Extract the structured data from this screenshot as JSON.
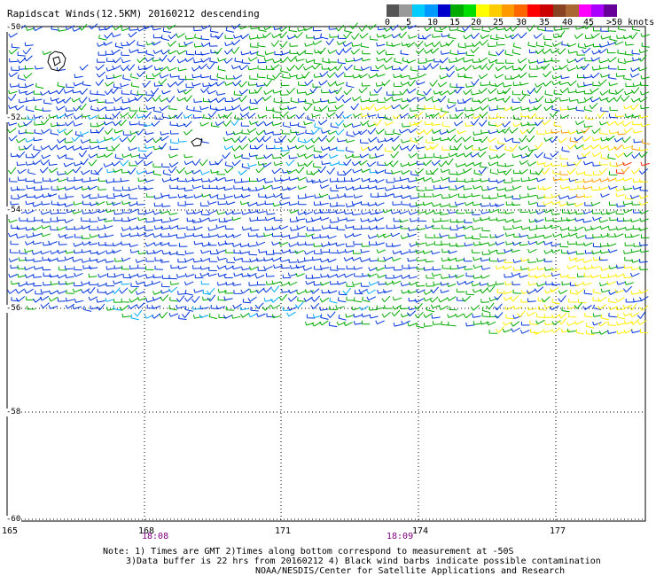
{
  "title": "Rapidscat Winds(12.5KM) 20160212 descending",
  "legend": {
    "colors": [
      "#555555",
      "#999999",
      "#00ccff",
      "#0099ff",
      "#0000cc",
      "#00aa00",
      "#00dd00",
      "#ffff00",
      "#ffcc00",
      "#ff9900",
      "#ff6600",
      "#ff0000",
      "#cc0000",
      "#884422",
      "#aa6633",
      "#ff00ff",
      "#aa00ff",
      "#660099"
    ],
    "labels": [
      "0",
      "5",
      "10",
      "15",
      "20",
      "25",
      "30",
      "35",
      "40",
      "45",
      ">50 knots"
    ]
  },
  "latitude_labels": [
    "-50",
    "-52",
    "-54",
    "-56",
    "-58",
    "-60"
  ],
  "longitude_labels": [
    "165",
    "168",
    "171",
    "174",
    "177"
  ],
  "times": [
    "18:08",
    "18:09"
  ],
  "notes": [
    "Note: 1) Times are GMT 2)Times along bottom correspond to measurement at -50S",
    "3)Data buffer is 22 hrs from 20160212 4) Black wind barbs indicate possible contamination",
    "NOAA/NESDIS/Center for Satellite Applications and Research"
  ],
  "colors": {
    "blue": "#0033dd",
    "lightblue": "#00aaff",
    "green": "#00aa00",
    "yellow": "#ffee00",
    "orange": "#ff9900",
    "red": "#ff2200",
    "grid": "#000000"
  }
}
